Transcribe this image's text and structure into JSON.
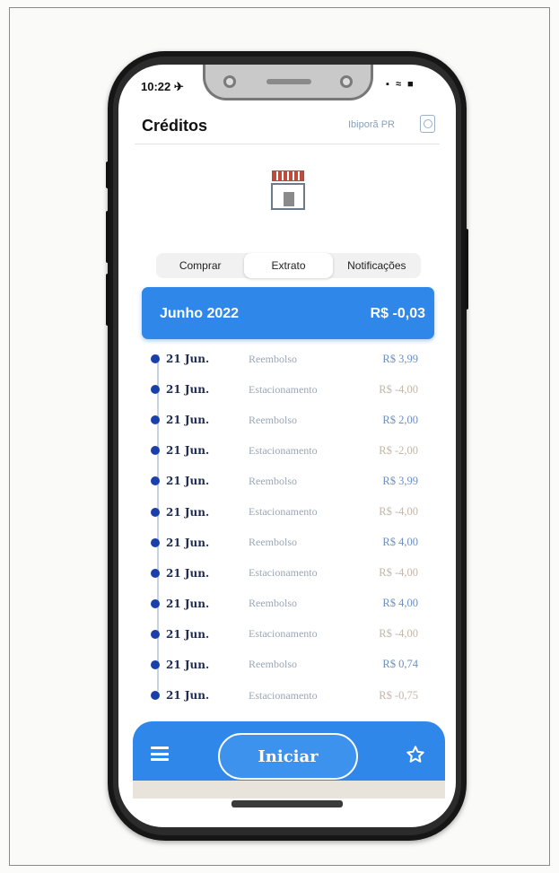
{
  "status_bar": {
    "time": "10:22 ✈",
    "icons": "▪ ≈ ■"
  },
  "header": {
    "title": "Créditos",
    "location": "Ibiporã PR"
  },
  "tabs": [
    {
      "label": "Comprar",
      "active": false
    },
    {
      "label": "Extrato",
      "active": true
    },
    {
      "label": "Notificações",
      "active": false
    }
  ],
  "summary": {
    "month": "Junho 2022",
    "total": "R$ -0,03"
  },
  "transactions": [
    {
      "date": "21 Jun.",
      "description": "Reembolso",
      "amount": "R$ 3,99",
      "sign": "pos"
    },
    {
      "date": "21 Jun.",
      "description": "Estacionamento",
      "amount": "R$ -4,00",
      "sign": "neg"
    },
    {
      "date": "21 Jun.",
      "description": "Reembolso",
      "amount": "R$ 2,00",
      "sign": "pos"
    },
    {
      "date": "21 Jun.",
      "description": "Estacionamento",
      "amount": "R$ -2,00",
      "sign": "neg"
    },
    {
      "date": "21 Jun.",
      "description": "Reembolso",
      "amount": "R$ 3,99",
      "sign": "pos"
    },
    {
      "date": "21 Jun.",
      "description": "Estacionamento",
      "amount": "R$ -4,00",
      "sign": "neg"
    },
    {
      "date": "21 Jun.",
      "description": "Reembolso",
      "amount": "R$ 4,00",
      "sign": "pos"
    },
    {
      "date": "21 Jun.",
      "description": "Estacionamento",
      "amount": "R$ -4,00",
      "sign": "neg"
    },
    {
      "date": "21 Jun.",
      "description": "Reembolso",
      "amount": "R$ 4,00",
      "sign": "pos"
    },
    {
      "date": "21 Jun.",
      "description": "Estacionamento",
      "amount": "R$ -4,00",
      "sign": "neg"
    },
    {
      "date": "21 Jun.",
      "description": "Reembolso",
      "amount": "R$ 0,74",
      "sign": "pos"
    },
    {
      "date": "21 Jun.",
      "description": "Estacionamento",
      "amount": "R$ -0,75",
      "sign": "neg"
    }
  ],
  "bottom_nav": {
    "start_label": "Iniciar",
    "menu_icon": "menu-icon",
    "favorite_icon": "star-icon"
  },
  "colors": {
    "accent": "#2f87ea",
    "dot": "#1a3fa8"
  }
}
